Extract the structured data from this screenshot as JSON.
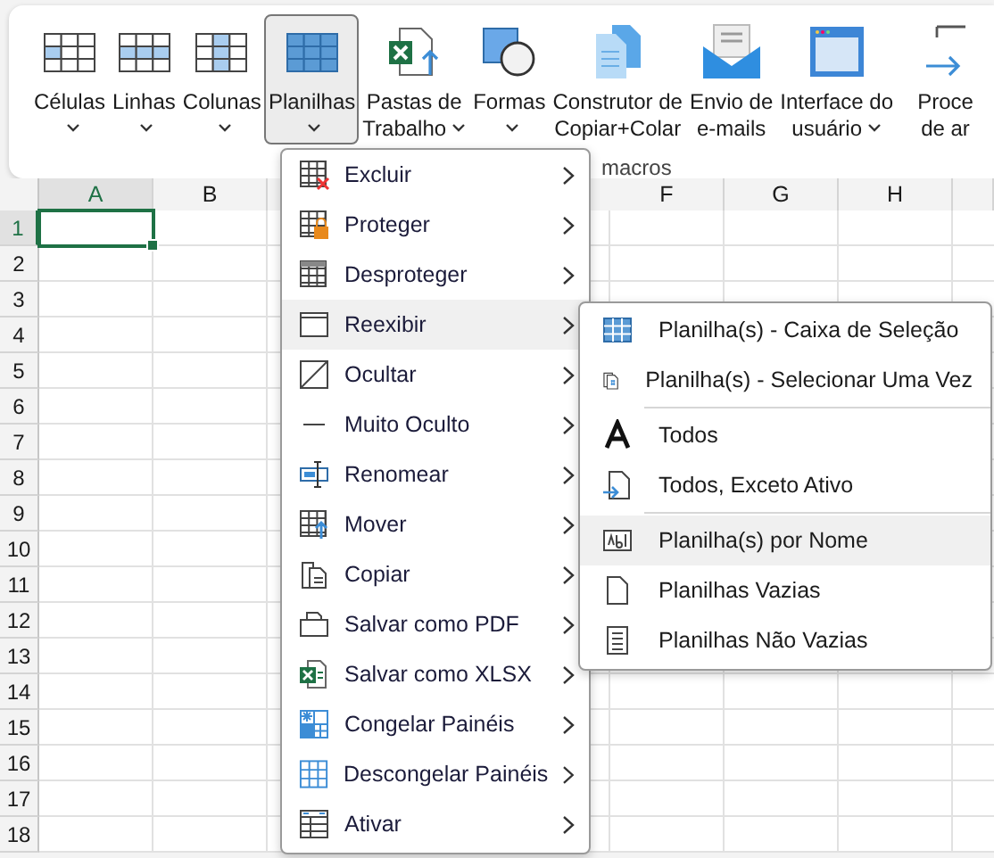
{
  "ribbon": {
    "buttons": [
      {
        "lines": [
          "Células"
        ],
        "dropdown": true,
        "selected": false
      },
      {
        "lines": [
          "Linhas"
        ],
        "dropdown": true,
        "selected": false
      },
      {
        "lines": [
          "Colunas"
        ],
        "dropdown": true,
        "selected": false
      },
      {
        "lines": [
          "Planilhas"
        ],
        "dropdown": true,
        "selected": true
      },
      {
        "lines": [
          "Pastas de",
          "Trabalho"
        ],
        "dropdown": true,
        "selected": false
      },
      {
        "lines": [
          "Formas"
        ],
        "dropdown": true,
        "selected": false
      },
      {
        "lines": [
          "Construtor de",
          "Copiar+Colar"
        ],
        "dropdown": false,
        "selected": false
      },
      {
        "lines": [
          "Envio de",
          "e-mails"
        ],
        "dropdown": false,
        "selected": false
      },
      {
        "lines": [
          "Interface do",
          "usuário"
        ],
        "dropdown": true,
        "selected": false
      },
      {
        "lines": [
          "Proce",
          "de ar"
        ],
        "dropdown": false,
        "selected": false
      }
    ],
    "group_label": "macros"
  },
  "grid": {
    "columns": [
      {
        "label": "A",
        "selected": true
      },
      {
        "label": "B",
        "selected": false
      },
      {
        "label": "F",
        "selected": false
      },
      {
        "label": "G",
        "selected": false
      },
      {
        "label": "H",
        "selected": false
      }
    ],
    "rows": [
      {
        "label": "1",
        "selected": true
      },
      {
        "label": "2",
        "selected": false
      },
      {
        "label": "3",
        "selected": false
      },
      {
        "label": "4",
        "selected": false
      },
      {
        "label": "5",
        "selected": false
      },
      {
        "label": "6",
        "selected": false
      },
      {
        "label": "7",
        "selected": false
      },
      {
        "label": "8",
        "selected": false
      },
      {
        "label": "9",
        "selected": false
      },
      {
        "label": "10",
        "selected": false
      },
      {
        "label": "11",
        "selected": false
      },
      {
        "label": "12",
        "selected": false
      },
      {
        "label": "13",
        "selected": false
      },
      {
        "label": "14",
        "selected": false
      },
      {
        "label": "15",
        "selected": false
      },
      {
        "label": "16",
        "selected": false
      },
      {
        "label": "17",
        "selected": false
      },
      {
        "label": "18",
        "selected": false
      }
    ]
  },
  "menu": {
    "items": [
      {
        "label": "Excluir",
        "selected": false
      },
      {
        "label": "Proteger",
        "selected": false
      },
      {
        "label": "Desproteger",
        "selected": false
      },
      {
        "label": "Reexibir",
        "selected": true
      },
      {
        "label": "Ocultar",
        "selected": false
      },
      {
        "label": "Muito Oculto",
        "selected": false
      },
      {
        "label": "Renomear",
        "selected": false
      },
      {
        "label": "Mover",
        "selected": false
      },
      {
        "label": "Copiar",
        "selected": false
      },
      {
        "label": "Salvar como PDF",
        "selected": false
      },
      {
        "label": "Salvar como XLSX",
        "selected": false
      },
      {
        "label": "Congelar Painéis",
        "selected": false
      },
      {
        "label": "Descongelar Painéis",
        "selected": false
      },
      {
        "label": "Ativar",
        "selected": false
      }
    ]
  },
  "submenu": {
    "groups": [
      [
        {
          "label": "Planilha(s) - Caixa de Seleção",
          "selected": false
        },
        {
          "label": "Planilha(s) - Selecionar Uma Vez",
          "selected": false
        }
      ],
      [
        {
          "label": "Todos",
          "selected": false
        },
        {
          "label": "Todos, Exceto Ativo",
          "selected": false
        }
      ],
      [
        {
          "label": "Planilha(s) por Nome",
          "selected": true
        },
        {
          "label": "Planilhas Vazias",
          "selected": false
        },
        {
          "label": "Planilhas Não Vazias",
          "selected": false
        }
      ]
    ]
  }
}
